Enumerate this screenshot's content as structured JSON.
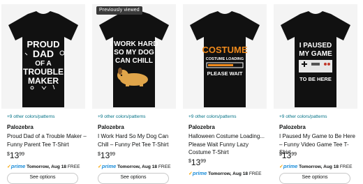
{
  "badge": "Previously viewed",
  "products": [
    {
      "shirt_lines": [
        "PROUD",
        "DAD",
        "OF A",
        "TROUBLE",
        "MAKER"
      ],
      "colors_link": "+9 other colors/patterns",
      "brand": "Palozebra",
      "title": "Proud Dad of a Trouble Maker – Funny Parent Tee T-Shirt",
      "price_symbol": "$",
      "price_whole": "13",
      "price_cents": "99",
      "prime_word": "prime",
      "delivery": "Tomorrow, Aug 18",
      "free": "FREE",
      "button": "See options"
    },
    {
      "shirt_lines": [
        "I WORK HARD",
        "SO MY DOG",
        "CAN CHILL"
      ],
      "colors_link": "+9 other colors/patterns",
      "brand": "Palozebra",
      "title": "I Work Hard So My Dog Can Chill – Funny Pet Tee T-Shirt",
      "price_symbol": "$",
      "price_whole": "13",
      "price_cents": "99",
      "prime_word": "prime",
      "delivery": "Tomorrow, Aug 18",
      "free": "FREE",
      "button": "See options"
    },
    {
      "shirt_lines": [
        "COSTUME",
        "COSTUME LOADING",
        "PLEASE WAIT"
      ],
      "colors_link": "+9 other colors/patterns",
      "brand": "Palozebra",
      "title": "Halloween Costume Loading... Please Wait Funny Lazy Costume T-Shirt",
      "price_symbol": "$",
      "price_whole": "13",
      "price_cents": "99",
      "prime_word": "prime",
      "delivery": "Tomorrow, Aug 18",
      "free": "FREE",
      "button": "See options"
    },
    {
      "shirt_lines": [
        "I PAUSED",
        "MY GAME",
        "TO BE HERE"
      ],
      "colors_link": "+9 other colors/patterns",
      "brand": "Palozebra",
      "title": "I Paused My Game to Be Here – Funny Video Game Tee T-Shirt",
      "price_symbol": "$",
      "price_whole": "13",
      "price_cents": "99",
      "prime_word": "prime",
      "delivery": "Tomorrow, Aug 18",
      "free": "FREE",
      "button": "See options"
    }
  ],
  "colors": {
    "link": "#007185",
    "prime_blue": "#1a8cd8",
    "check_orange": "#f7a300",
    "costume_orange": "#f08a1c"
  }
}
